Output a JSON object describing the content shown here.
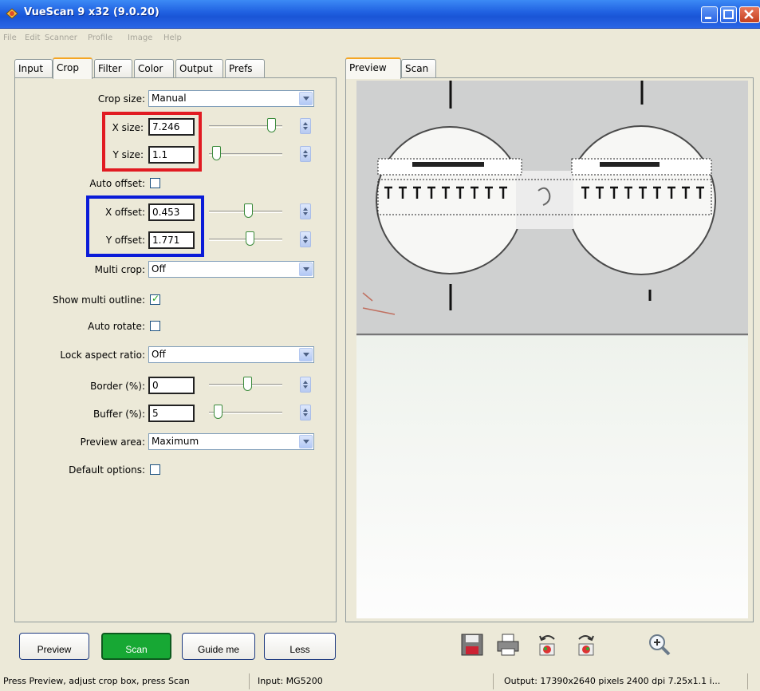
{
  "window": {
    "title": "VueScan 9 x32 (9.0.20)",
    "titlebar_color": "#2a66e6"
  },
  "menu": [
    "File",
    "Edit",
    "Scanner",
    "Profile",
    "Image",
    "Help"
  ],
  "left_tabs": [
    "Input",
    "Crop",
    "Filter",
    "Color",
    "Output",
    "Prefs"
  ],
  "active_left_tab": "Crop",
  "right_tabs": [
    "Preview",
    "Scan"
  ],
  "active_right_tab": "Preview",
  "crop": {
    "crop_size": {
      "label": "Crop size:",
      "value": "Manual"
    },
    "x_size": {
      "label": "X size:",
      "value": "7.246"
    },
    "y_size": {
      "label": "Y size:",
      "value": "1.1"
    },
    "auto_offset": {
      "label": "Auto offset:"
    },
    "x_offset": {
      "label": "X offset:",
      "value": "0.453"
    },
    "y_offset": {
      "label": "Y offset:",
      "value": "1.771"
    },
    "multi_crop": {
      "label": "Multi crop:",
      "value": "Off"
    },
    "show_multi_outline": {
      "label": "Show multi outline:",
      "checked": true
    },
    "auto_rotate": {
      "label": "Auto rotate:"
    },
    "lock_aspect_ratio": {
      "label": "Lock aspect ratio:",
      "value": "Off"
    },
    "border": {
      "label": "Border (%):",
      "value": "0"
    },
    "buffer": {
      "label": "Buffer (%):",
      "value": "5"
    },
    "preview_area": {
      "label": "Preview area:",
      "value": "Maximum"
    },
    "default_options": {
      "label": "Default options:"
    }
  },
  "buttons": {
    "preview": "Preview",
    "scan": "Scan",
    "guide": "Guide me",
    "less": "Less"
  },
  "toolbar_icons": [
    "save-icon",
    "print-icon",
    "rotate-left-icon",
    "rotate-right-icon",
    "zoom-in-icon"
  ],
  "status": {
    "hint": "Press Preview, adjust crop box, press Scan",
    "input": "Input: MG5200",
    "output": "Output: 17390x2640 pixels 2400 dpi 7.25x1.1 i..."
  },
  "colors": {
    "highlight_red": "#e11b22",
    "highlight_blue": "#0a1bd8",
    "scan_button": "#17a834"
  }
}
